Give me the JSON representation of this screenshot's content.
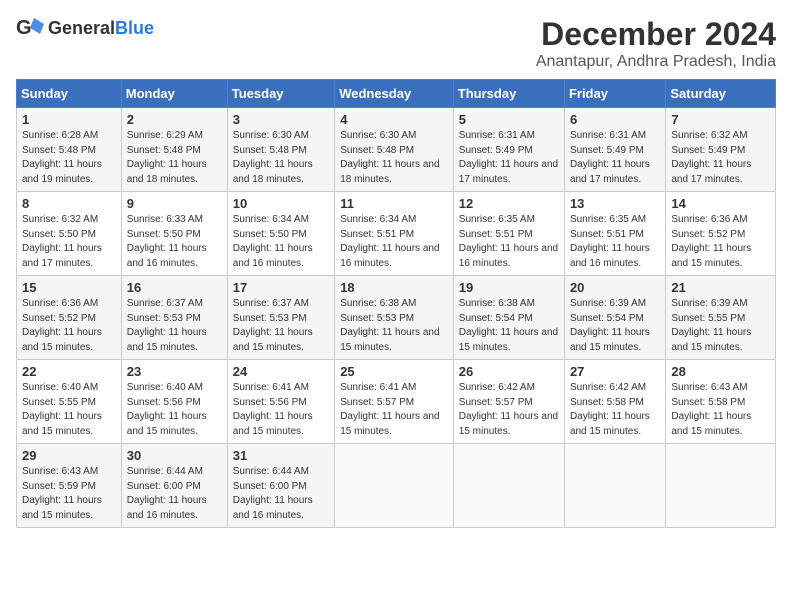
{
  "logo": {
    "text_general": "General",
    "text_blue": "Blue"
  },
  "title": "December 2024",
  "subtitle": "Anantapur, Andhra Pradesh, India",
  "days_of_week": [
    "Sunday",
    "Monday",
    "Tuesday",
    "Wednesday",
    "Thursday",
    "Friday",
    "Saturday"
  ],
  "weeks": [
    [
      {
        "day": "1",
        "sunrise": "6:28 AM",
        "sunset": "5:48 PM",
        "daylight": "11 hours and 19 minutes."
      },
      {
        "day": "2",
        "sunrise": "6:29 AM",
        "sunset": "5:48 PM",
        "daylight": "11 hours and 18 minutes."
      },
      {
        "day": "3",
        "sunrise": "6:30 AM",
        "sunset": "5:48 PM",
        "daylight": "11 hours and 18 minutes."
      },
      {
        "day": "4",
        "sunrise": "6:30 AM",
        "sunset": "5:48 PM",
        "daylight": "11 hours and 18 minutes."
      },
      {
        "day": "5",
        "sunrise": "6:31 AM",
        "sunset": "5:49 PM",
        "daylight": "11 hours and 17 minutes."
      },
      {
        "day": "6",
        "sunrise": "6:31 AM",
        "sunset": "5:49 PM",
        "daylight": "11 hours and 17 minutes."
      },
      {
        "day": "7",
        "sunrise": "6:32 AM",
        "sunset": "5:49 PM",
        "daylight": "11 hours and 17 minutes."
      }
    ],
    [
      {
        "day": "8",
        "sunrise": "6:32 AM",
        "sunset": "5:50 PM",
        "daylight": "11 hours and 17 minutes."
      },
      {
        "day": "9",
        "sunrise": "6:33 AM",
        "sunset": "5:50 PM",
        "daylight": "11 hours and 16 minutes."
      },
      {
        "day": "10",
        "sunrise": "6:34 AM",
        "sunset": "5:50 PM",
        "daylight": "11 hours and 16 minutes."
      },
      {
        "day": "11",
        "sunrise": "6:34 AM",
        "sunset": "5:51 PM",
        "daylight": "11 hours and 16 minutes."
      },
      {
        "day": "12",
        "sunrise": "6:35 AM",
        "sunset": "5:51 PM",
        "daylight": "11 hours and 16 minutes."
      },
      {
        "day": "13",
        "sunrise": "6:35 AM",
        "sunset": "5:51 PM",
        "daylight": "11 hours and 16 minutes."
      },
      {
        "day": "14",
        "sunrise": "6:36 AM",
        "sunset": "5:52 PM",
        "daylight": "11 hours and 15 minutes."
      }
    ],
    [
      {
        "day": "15",
        "sunrise": "6:36 AM",
        "sunset": "5:52 PM",
        "daylight": "11 hours and 15 minutes."
      },
      {
        "day": "16",
        "sunrise": "6:37 AM",
        "sunset": "5:53 PM",
        "daylight": "11 hours and 15 minutes."
      },
      {
        "day": "17",
        "sunrise": "6:37 AM",
        "sunset": "5:53 PM",
        "daylight": "11 hours and 15 minutes."
      },
      {
        "day": "18",
        "sunrise": "6:38 AM",
        "sunset": "5:53 PM",
        "daylight": "11 hours and 15 minutes."
      },
      {
        "day": "19",
        "sunrise": "6:38 AM",
        "sunset": "5:54 PM",
        "daylight": "11 hours and 15 minutes."
      },
      {
        "day": "20",
        "sunrise": "6:39 AM",
        "sunset": "5:54 PM",
        "daylight": "11 hours and 15 minutes."
      },
      {
        "day": "21",
        "sunrise": "6:39 AM",
        "sunset": "5:55 PM",
        "daylight": "11 hours and 15 minutes."
      }
    ],
    [
      {
        "day": "22",
        "sunrise": "6:40 AM",
        "sunset": "5:55 PM",
        "daylight": "11 hours and 15 minutes."
      },
      {
        "day": "23",
        "sunrise": "6:40 AM",
        "sunset": "5:56 PM",
        "daylight": "11 hours and 15 minutes."
      },
      {
        "day": "24",
        "sunrise": "6:41 AM",
        "sunset": "5:56 PM",
        "daylight": "11 hours and 15 minutes."
      },
      {
        "day": "25",
        "sunrise": "6:41 AM",
        "sunset": "5:57 PM",
        "daylight": "11 hours and 15 minutes."
      },
      {
        "day": "26",
        "sunrise": "6:42 AM",
        "sunset": "5:57 PM",
        "daylight": "11 hours and 15 minutes."
      },
      {
        "day": "27",
        "sunrise": "6:42 AM",
        "sunset": "5:58 PM",
        "daylight": "11 hours and 15 minutes."
      },
      {
        "day": "28",
        "sunrise": "6:43 AM",
        "sunset": "5:58 PM",
        "daylight": "11 hours and 15 minutes."
      }
    ],
    [
      {
        "day": "29",
        "sunrise": "6:43 AM",
        "sunset": "5:59 PM",
        "daylight": "11 hours and 15 minutes."
      },
      {
        "day": "30",
        "sunrise": "6:44 AM",
        "sunset": "6:00 PM",
        "daylight": "11 hours and 16 minutes."
      },
      {
        "day": "31",
        "sunrise": "6:44 AM",
        "sunset": "6:00 PM",
        "daylight": "11 hours and 16 minutes."
      },
      null,
      null,
      null,
      null
    ]
  ]
}
